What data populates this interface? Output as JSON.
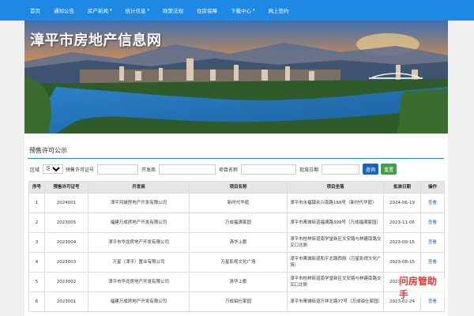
{
  "nav": {
    "items": [
      {
        "label": "首页",
        "dropdown": false
      },
      {
        "label": "通知公告",
        "dropdown": false
      },
      {
        "label": "房产新闻",
        "dropdown": true
      },
      {
        "label": "统计信息",
        "dropdown": true
      },
      {
        "label": "政策法规",
        "dropdown": false
      },
      {
        "label": "住房保障",
        "dropdown": false
      },
      {
        "label": "下载中心",
        "dropdown": true
      },
      {
        "label": "网上签约",
        "dropdown": false
      }
    ],
    "caret_icon": "▾"
  },
  "banner": {
    "title": "漳平市房地产信息网"
  },
  "section": {
    "title": "预售许可公示"
  },
  "filters": {
    "region_label": "区域",
    "region_selected": "区域",
    "permit_label": "预售许可证号",
    "developer_label": "开发商",
    "project_label": "项目名称",
    "date_label": "批准日期",
    "search_button": "查询",
    "reset_button": "重置"
  },
  "table": {
    "headers": [
      "序号",
      "预售许可证号",
      "开发商",
      "项目名称",
      "项目坐落",
      "批准日期",
      "操作"
    ],
    "rows": [
      {
        "no": "1",
        "permit": "2024001",
        "developer": "漳平鸿城房地产开发有限公司",
        "project": "新时代华庭",
        "address": "漳平市永福镇永兴南路168号（新时代华庭）",
        "date": "2024-06-19",
        "action": "查看"
      },
      {
        "no": "2",
        "permit": "2023005",
        "developer": "福建万成房地产开发有限公司",
        "project": "万成福满家园",
        "address": "漳平市菁城街道福满路399号（万成福满家园）",
        "date": "2023-11-06",
        "action": "查看"
      },
      {
        "no": "3",
        "permit": "2023004",
        "developer": "漳平市华龙房地产开发有限公司",
        "project": "清华上郡",
        "address": "漳平市桂林街道南学堂新区文安路与林建南路交叉口北侧",
        "date": "2023-09-15",
        "action": "查看"
      },
      {
        "no": "4",
        "permit": "2023003",
        "developer": "万星（漳平）置业有限公司",
        "project": "万星影视文化广场",
        "address": "漳平市菁城街道和平北路西侧（万星影视文化广场）",
        "date": "2023-08-15",
        "action": "查看"
      },
      {
        "no": "5",
        "permit": "2023002",
        "developer": "漳平市华龙房地产开发有限公司",
        "project": "清华上郡",
        "address": "漳平市桂林街道南学堂新区文安路与林建南路交叉口北侧",
        "date": "2023-07-13",
        "action": "查看"
      },
      {
        "no": "6",
        "permit": "2023001",
        "developer": "福建万成房地产开发有限公司",
        "project": "万成铂仕家园",
        "address": "漳平市菁城街道万祥北路77号（万成铂仕家园）",
        "date": "2023-02-24",
        "action": "查看"
      }
    ]
  },
  "watermark": {
    "text": "问房管助手"
  },
  "colors": {
    "nav_bg": "#1e88e5",
    "search_button": "#1565c0",
    "reset_button": "#43a047",
    "link": "#1565c0",
    "watermark": "#e53935"
  }
}
